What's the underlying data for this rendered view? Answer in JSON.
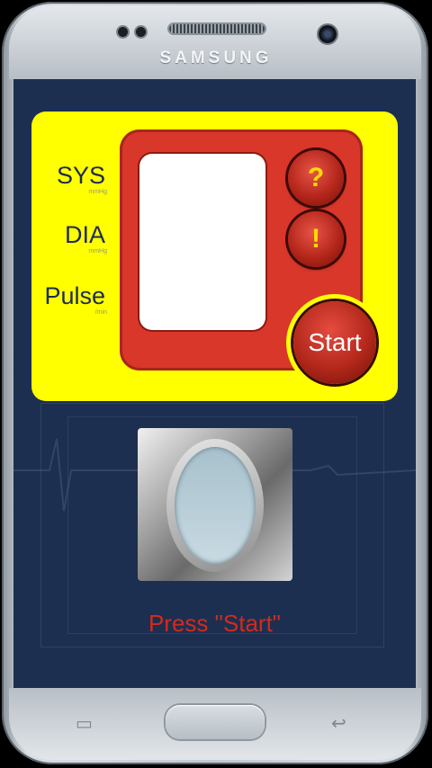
{
  "device": {
    "brand": "SAMSUNG"
  },
  "readings": {
    "sys_label": "SYS",
    "sys_unit": "mmHg",
    "dia_label": "DIA",
    "dia_unit": "mmHg",
    "pulse_label": "Pulse",
    "pulse_unit": "/min"
  },
  "buttons": {
    "help_label": "?",
    "info_label": "!",
    "start_label": "Start"
  },
  "status": {
    "message": "Press \"Start\""
  },
  "nav": {
    "recents_icon": "recent-apps-icon",
    "back_icon": "back-arrow-icon"
  },
  "colors": {
    "panel": "#ffff00",
    "device_body": "#d9372a",
    "screen_bg": "#1c2f50",
    "message": "#d32a1e"
  }
}
